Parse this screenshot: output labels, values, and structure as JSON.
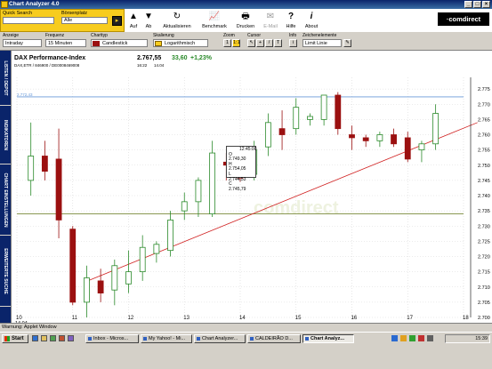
{
  "window": {
    "title": "Chart Analyzer 4.0",
    "min": "_",
    "max": "□",
    "close": "×"
  },
  "top": {
    "quick_search_label": "Quick Search",
    "quick_search_value": "",
    "boersenplatz_label": "Börsenplatz",
    "boersenplatz_value": "Alle",
    "go_label": "▸"
  },
  "toolbar": [
    {
      "label": "Auf",
      "icon": "▲",
      "name": "sort-up"
    },
    {
      "label": "Ab",
      "icon": "▼",
      "name": "sort-down"
    },
    {
      "label": "Aktualisieren",
      "icon": "↻",
      "name": "refresh"
    },
    {
      "label": "Benchmark",
      "icon": "📈",
      "name": "benchmark"
    },
    {
      "label": "Drucken",
      "icon": "🖶",
      "name": "print"
    },
    {
      "label": "E-Mail",
      "icon": "✉",
      "name": "email",
      "disabled": true
    },
    {
      "label": "Hilfe",
      "icon": "?",
      "name": "help"
    },
    {
      "label": "About",
      "icon": "i",
      "name": "about"
    }
  ],
  "logo": "·comdirect",
  "controls": {
    "anzeige_label": "Anzeige",
    "anzeige_value": "Intraday",
    "frequenz_label": "Frequenz",
    "frequenz_value": "15 Minuten",
    "charttyp_label": "Charttyp",
    "charttyp_value": "Candlestick",
    "skalierung_label": "Skalierung",
    "skalierung_value": "Logarithmisch",
    "zoom_label": "Zoom",
    "zoom_btn1": "1",
    "zoom_btn2": "1:1",
    "cursor_label": "Cursor",
    "info_label": "Info",
    "zeichenelemente_label": "Zeichenelemente",
    "zeichenelemente_value": "Limit Linie"
  },
  "side_tabs": [
    "LISTEN / DEPOT",
    "INDIKATOREN",
    "CHART EINSTELLUNGEN",
    "ERWEITERTE SUCHE"
  ],
  "instrument": {
    "name": "DAX Performance-Index",
    "price": "2.767,55",
    "change": "33,60",
    "change_pct": "+1,23%",
    "ids": "DAX,ETR / 846900 / DE0008469008",
    "time": "16:22",
    "date": "14.04",
    "limit_label": "2.772,43"
  },
  "tooltip": {
    "time": "12:45:00",
    "o_label": "O",
    "o": "2.749,30",
    "h_label": "H",
    "h": "2.754,05",
    "l_label": "L",
    "l": "2.744,53",
    "c_label": "C",
    "c": "2.745,79"
  },
  "watermark": "comdirect",
  "status": {
    "text": "Warnung: Applet Window"
  },
  "taskbar": {
    "start": "Start",
    "tasks": [
      {
        "label": "Inbox - Micros...",
        "active": false
      },
      {
        "label": "My Yahoo! - Mi...",
        "active": false
      },
      {
        "label": "Chart Analyzer...",
        "active": false
      },
      {
        "label": "CALDEIRÃO D...",
        "active": false
      },
      {
        "label": "Chart Analyz...",
        "active": true
      }
    ],
    "clock": "15:39"
  },
  "colors": {
    "accent": "#f7cc1e",
    "titlebar": "#0a246a",
    "up_candle": "#ffffff",
    "up_border": "#2a8a2a",
    "down_candle": "#9b1010",
    "trendline": "#d02020",
    "limit_line": "#6a9ad8",
    "support_line": "#7a8a3a"
  },
  "chart_data": {
    "type": "candlestick",
    "x_tick_labels": [
      "10",
      "11",
      "12",
      "13",
      "14",
      "15",
      "16",
      "17",
      "18"
    ],
    "x_tick_sublabel": "14.04",
    "y_tick_labels": [
      "2.775",
      "2.770",
      "2.765",
      "2.760",
      "2.755",
      "2.750",
      "2.745",
      "2.740",
      "2.735",
      "2.730",
      "2.725",
      "2.720",
      "2.715",
      "2.710",
      "2.705",
      "2.700"
    ],
    "ylim": [
      2700,
      2776.5
    ],
    "xlim": [
      10,
      18
    ],
    "limit_line": 2772.43,
    "support_line": 2734,
    "trendline": {
      "x1": 11.2,
      "y1": 2711.5,
      "x2": 18.25,
      "y2": 2764.0
    },
    "candles": [
      {
        "x": 10.25,
        "o": 2745,
        "h": 2764,
        "l": 2740,
        "c": 2753
      },
      {
        "x": 10.5,
        "o": 2753,
        "h": 2758,
        "l": 2745,
        "c": 2748
      },
      {
        "x": 10.75,
        "o": 2752,
        "h": 2762,
        "l": 2726,
        "c": 2732
      },
      {
        "x": 11.0,
        "o": 2729,
        "h": 2730,
        "l": 2704,
        "c": 2705
      },
      {
        "x": 11.25,
        "o": 2705,
        "h": 2717,
        "l": 2700,
        "c": 2713
      },
      {
        "x": 11.5,
        "o": 2712,
        "h": 2716,
        "l": 2705,
        "c": 2708
      },
      {
        "x": 11.75,
        "o": 2709,
        "h": 2719,
        "l": 2704,
        "c": 2717
      },
      {
        "x": 12.0,
        "o": 2711,
        "h": 2722,
        "l": 2708,
        "c": 2715
      },
      {
        "x": 12.25,
        "o": 2715,
        "h": 2727,
        "l": 2712,
        "c": 2723
      },
      {
        "x": 12.5,
        "o": 2721,
        "h": 2725,
        "l": 2718,
        "c": 2724
      },
      {
        "x": 12.75,
        "o": 2722,
        "h": 2735,
        "l": 2720,
        "c": 2732
      },
      {
        "x": 13.0,
        "o": 2735,
        "h": 2741,
        "l": 2732,
        "c": 2738
      },
      {
        "x": 13.25,
        "o": 2738,
        "h": 2746,
        "l": 2733,
        "c": 2745
      },
      {
        "x": 13.5,
        "o": 2734,
        "h": 2758,
        "l": 2733,
        "c": 2754
      },
      {
        "x": 13.75,
        "o": 2751,
        "h": 2754,
        "l": 2745,
        "c": 2750
      },
      {
        "x": 14.0,
        "o": 2749.3,
        "h": 2754.05,
        "l": 2744.53,
        "c": 2745.79
      },
      {
        "x": 14.25,
        "o": 2747,
        "h": 2758,
        "l": 2745,
        "c": 2755
      },
      {
        "x": 14.5,
        "o": 2756,
        "h": 2767,
        "l": 2753,
        "c": 2764
      },
      {
        "x": 14.75,
        "o": 2762,
        "h": 2768,
        "l": 2755,
        "c": 2760
      },
      {
        "x": 15.0,
        "o": 2762,
        "h": 2772,
        "l": 2760,
        "c": 2769
      },
      {
        "x": 15.25,
        "o": 2765,
        "h": 2767,
        "l": 2763,
        "c": 2766
      },
      {
        "x": 15.5,
        "o": 2765,
        "h": 2771,
        "l": 2763,
        "c": 2773
      },
      {
        "x": 15.75,
        "o": 2773,
        "h": 2774,
        "l": 2760,
        "c": 2762
      },
      {
        "x": 16.0,
        "o": 2760,
        "h": 2763,
        "l": 2755,
        "c": 2759
      },
      {
        "x": 16.25,
        "o": 2759,
        "h": 2760,
        "l": 2756,
        "c": 2758
      },
      {
        "x": 16.5,
        "o": 2758,
        "h": 2761,
        "l": 2756,
        "c": 2760
      },
      {
        "x": 16.75,
        "o": 2760,
        "h": 2762,
        "l": 2756,
        "c": 2757
      },
      {
        "x": 17.0,
        "o": 2759,
        "h": 2761,
        "l": 2751,
        "c": 2752
      },
      {
        "x": 17.25,
        "o": 2755,
        "h": 2758,
        "l": 2751,
        "c": 2757
      },
      {
        "x": 17.5,
        "o": 2757,
        "h": 2770,
        "l": 2755,
        "c": 2767
      }
    ]
  }
}
